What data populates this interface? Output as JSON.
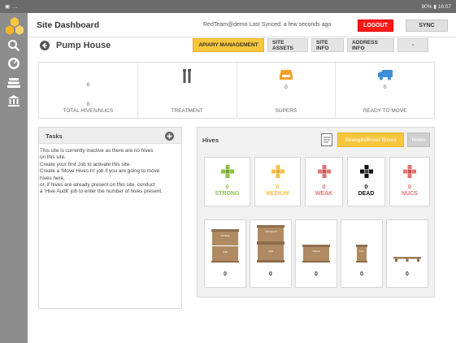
{
  "status_bar": {
    "left": "...",
    "right": "90% ▮ 16:07"
  },
  "header": {
    "site_title": "Site Dashboard",
    "user_info": "RedTeam@demo  Last Synced:  a few seconds ago",
    "logout_label": "LOGOUT",
    "sync_label": "SYNC"
  },
  "page": {
    "title": "Pump House",
    "tabs": [
      {
        "label": "APIARY MANAGEMENT",
        "active": true
      },
      {
        "label": "SITE ASSETS",
        "active": false
      },
      {
        "label": "SITE INFO",
        "active": false
      },
      {
        "label": "ADDRESS INFO",
        "active": false
      },
      {
        "label": "-",
        "active": false
      }
    ]
  },
  "stats": [
    {
      "value": "0",
      "sub_value": "0",
      "label": "TOTAL HIVES/NUCS",
      "icon": "none"
    },
    {
      "value": "",
      "label": "TREATMENT",
      "icon": "treatment-icon"
    },
    {
      "value": "0",
      "label": "SUPERS",
      "icon": "super-box-icon"
    },
    {
      "value": "0",
      "label": "READY TO MOVE",
      "icon": "truck-icon"
    }
  ],
  "tasks": {
    "title": "Tasks",
    "lines": [
      "This site is currently inactive as there are no hives",
      "on this site.",
      "Create your first Job to activate this site.",
      "Create a 'Move Hives In' job if you are going to move",
      "hives here,",
      "or, if hives are already present on this site, conduct",
      "a 'Hive Audit' job to enter the number of hives present."
    ]
  },
  "hives": {
    "title": "Hives",
    "strength_button": "Strength/Brood Boxes",
    "notes_button": "Notes",
    "strength": [
      {
        "value": "0",
        "label": "STRONG",
        "color": "#8bc34a"
      },
      {
        "value": "0",
        "label": "MEDIUM",
        "color": "#f5c146"
      },
      {
        "value": "0",
        "label": "WEAK",
        "color": "#e57373"
      },
      {
        "value": "0",
        "label": "DEAD",
        "color": "#111111"
      },
      {
        "value": "0",
        "label": "NUCS",
        "color": "#e57373"
      }
    ],
    "boxes": [
      {
        "value": "0",
        "labels": [
          "DOUBLE",
          "HIVE"
        ]
      },
      {
        "value": "0",
        "labels": [
          "TOP SPLITS",
          "HIVE"
        ]
      },
      {
        "value": "0",
        "labels": [
          "SINGLE"
        ]
      },
      {
        "value": "0",
        "labels": [
          "NUC"
        ]
      },
      {
        "value": "0",
        "labels": []
      }
    ]
  },
  "colors": {
    "accent": "#f7c63c",
    "logout": "#ff1a1a",
    "sidebar": "#8d8d8d"
  }
}
